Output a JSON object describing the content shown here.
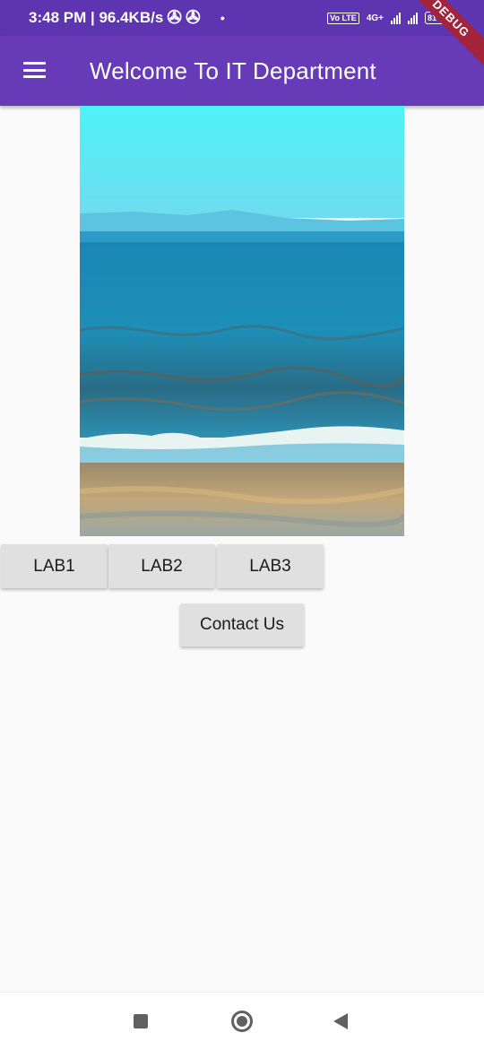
{
  "status_bar": {
    "time_speed": "3:48 PM | 96.4KB/s",
    "fan_glyph": "✇",
    "dot": "•",
    "volte_label": "Vo LTE",
    "network_label": "4G+",
    "battery_level": "81"
  },
  "app_bar": {
    "title": "Welcome To IT Department",
    "menu_icon": "hamburger-menu-icon",
    "debug_banner": "DEBUG"
  },
  "hero_image": {
    "subject": "beach-ocean-photo"
  },
  "buttons": {
    "lab1": "LAB1",
    "lab2": "LAB2",
    "lab3": "LAB3",
    "contact": "Contact Us"
  },
  "nav_bar": {
    "recents_icon": "square-icon",
    "home_icon": "circle-icon",
    "back_icon": "back-triangle-icon"
  },
  "colors": {
    "status_bar": "#5e35b1",
    "app_bar": "#673ab7",
    "button_bg": "#e0e0e0",
    "page_bg": "#fafafa"
  }
}
